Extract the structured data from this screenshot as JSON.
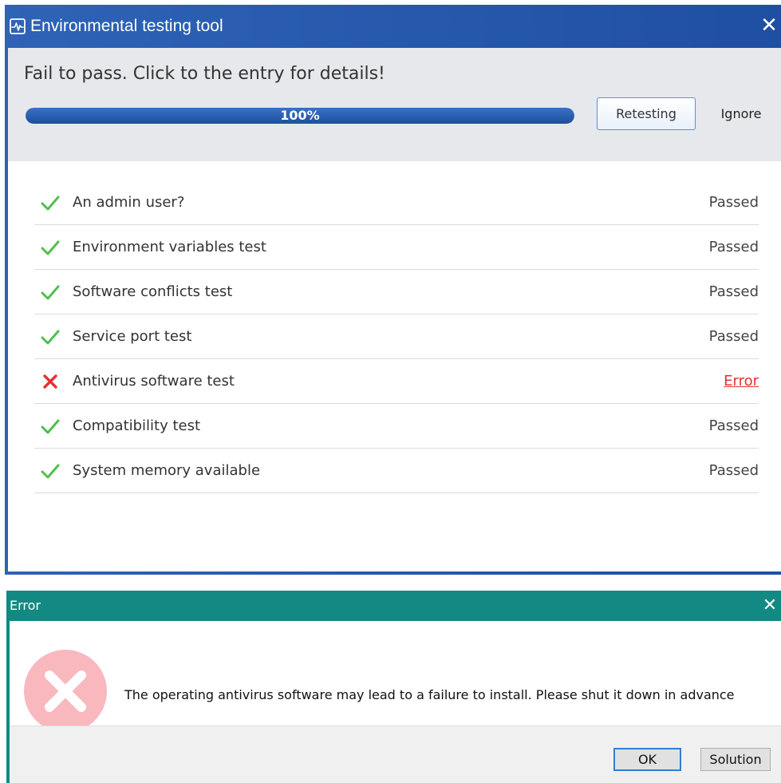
{
  "main_window": {
    "title": "Environmental testing tool",
    "close_glyph": "✕",
    "summary": "Fail to pass. Click to the entry for details!",
    "progress": {
      "value": 100,
      "label": "100%"
    },
    "retest_label": "Retesting",
    "ignore_label": "Ignore",
    "tests": [
      {
        "name": "An admin user?",
        "status": "Passed",
        "result": "pass"
      },
      {
        "name": "Environment variables test",
        "status": "Passed",
        "result": "pass"
      },
      {
        "name": "Software conflicts test",
        "status": "Passed",
        "result": "pass"
      },
      {
        "name": "Service port test",
        "status": "Passed",
        "result": "pass"
      },
      {
        "name": "Antivirus software test",
        "status": "Error",
        "result": "fail"
      },
      {
        "name": "Compatibility test",
        "status": "Passed",
        "result": "pass"
      },
      {
        "name": "System memory available",
        "status": "Passed",
        "result": "pass"
      }
    ]
  },
  "error_dialog": {
    "title": "Error",
    "close_glyph": "✕",
    "message": "The operating antivirus software may lead to a failure to install. Please shut it down in advance",
    "ok_label": "OK",
    "solution_label": "Solution"
  },
  "icons": {
    "app": "pulse-monitor-icon",
    "pass": "checkmark-icon",
    "fail": "red-x-icon",
    "error": "error-circle-icon"
  },
  "colors": {
    "title_bar": "#2e63b6",
    "dialog_title_bar": "#128a83",
    "pass": "#4fc04f",
    "fail": "#e8302f",
    "error_circle": "#f9b8be"
  }
}
